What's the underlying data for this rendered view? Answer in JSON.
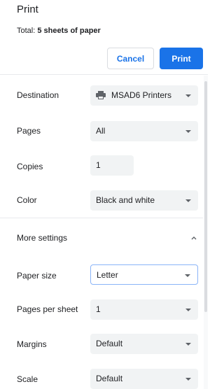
{
  "header": {
    "title": "Print",
    "total_prefix": "Total: ",
    "total_value": "5 sheets of paper",
    "cancel_label": "Cancel",
    "print_label": "Print"
  },
  "settings": {
    "destination": {
      "label": "Destination",
      "value": "MSAD6 Printers",
      "icon": "printer-icon"
    },
    "pages": {
      "label": "Pages",
      "value": "All"
    },
    "copies": {
      "label": "Copies",
      "value": "1"
    },
    "color": {
      "label": "Color",
      "value": "Black and white"
    },
    "more_settings": {
      "label": "More settings",
      "icon": "chevron-up-icon"
    },
    "paper_size": {
      "label": "Paper size",
      "value": "Letter"
    },
    "pages_per_sheet": {
      "label": "Pages per sheet",
      "value": "1"
    },
    "margins": {
      "label": "Margins",
      "value": "Default"
    },
    "scale": {
      "label": "Scale",
      "value": "Default"
    }
  },
  "colors": {
    "accent": "#1a73e8",
    "field_bg": "#f1f3f4",
    "text": "#202124",
    "divider": "#e8eaed"
  }
}
